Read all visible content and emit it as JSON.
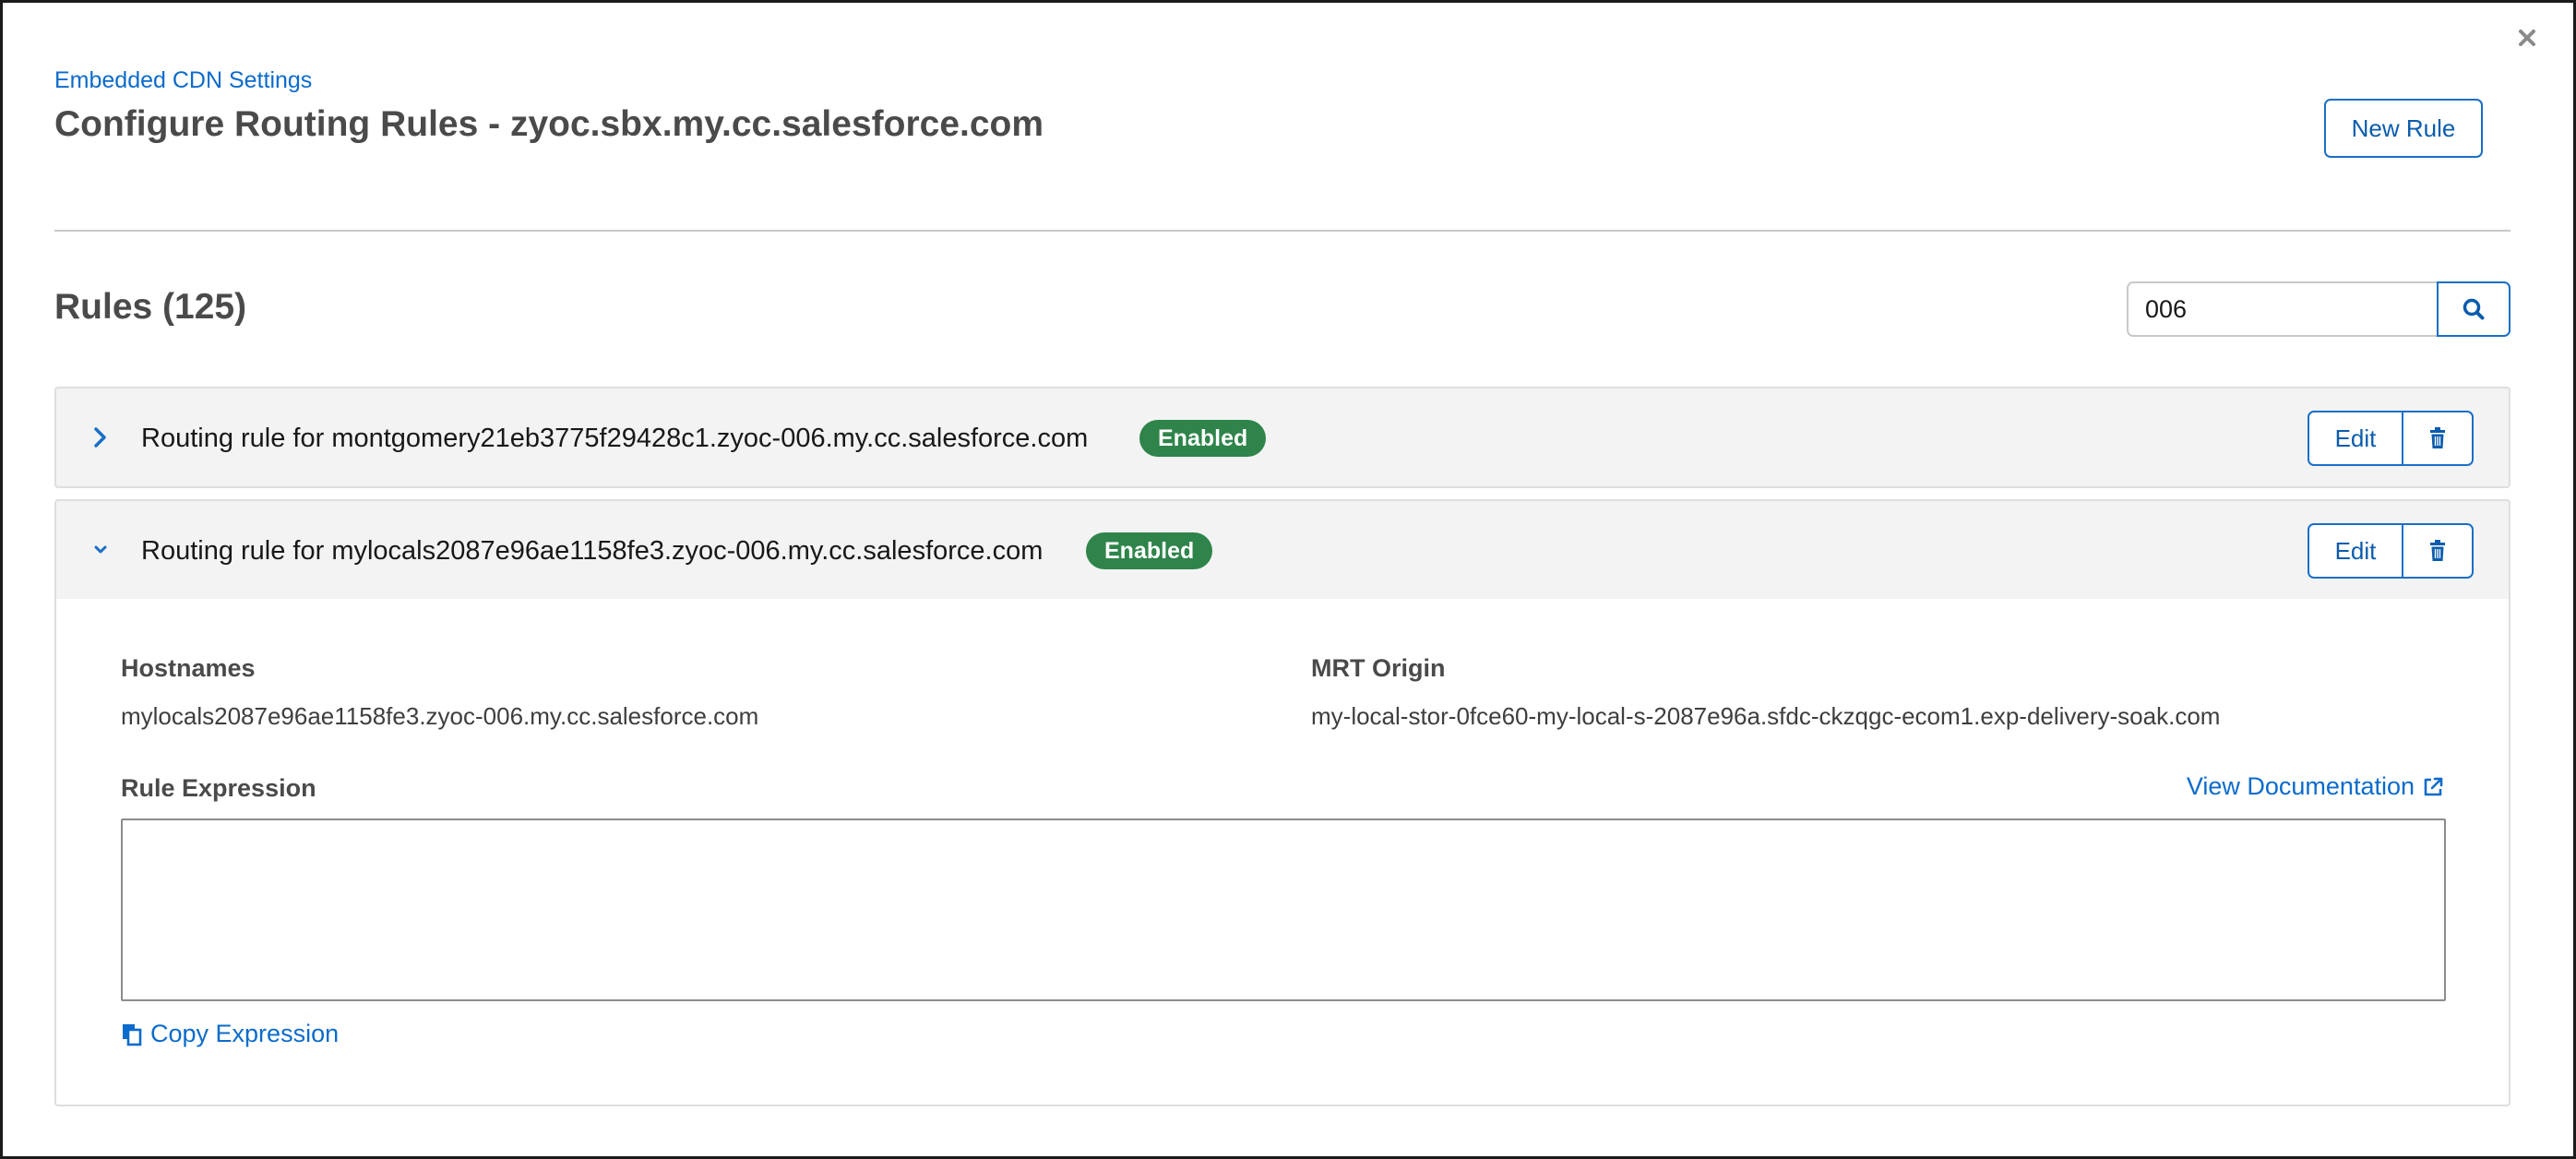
{
  "header": {
    "breadcrumb": "Embedded CDN Settings",
    "title": "Configure Routing Rules - zyoc.sbx.my.cc.salesforce.com",
    "new_rule_label": "New Rule",
    "close_icon": "close-icon"
  },
  "rules_section": {
    "heading": "Rules (125)",
    "search": {
      "value": "006",
      "placeholder": ""
    },
    "search_icon": "search-icon"
  },
  "rules": [
    {
      "title": "Routing rule for montgomery21eb3775f29428c1.zyoc-006.my.cc.salesforce.com",
      "status": "Enabled",
      "expanded": false,
      "edit_label": "Edit"
    },
    {
      "title": "Routing rule for mylocals2087e96ae1158fe3.zyoc-006.my.cc.salesforce.com",
      "status": "Enabled",
      "expanded": true,
      "edit_label": "Edit",
      "details": {
        "hostnames_label": "Hostnames",
        "hostnames_value": "mylocals2087e96ae1158fe3.zyoc-006.my.cc.salesforce.com",
        "origin_label": "MRT Origin",
        "origin_value": "my-local-stor-0fce60-my-local-s-2087e96a.sfdc-ckzqgc-ecom1.exp-delivery-soak.com",
        "expression_label": "Rule Expression",
        "expression_value": "",
        "doc_link": "View Documentation",
        "copy_link": "Copy Expression"
      }
    }
  ],
  "colors": {
    "link": "#0b6bcb",
    "badge_green": "#2e844a",
    "button_border": "#1a6fc6",
    "header_bg": "#f3f3f3"
  }
}
